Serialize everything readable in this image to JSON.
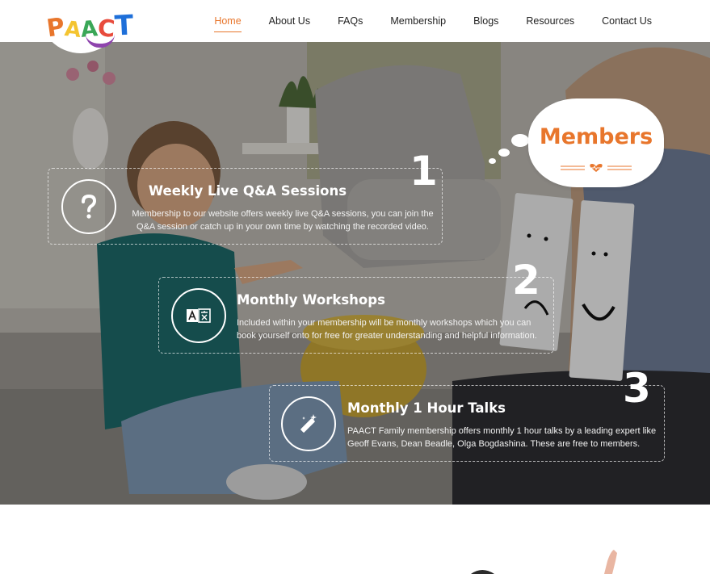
{
  "brand": {
    "logo_letters": [
      "P",
      "A",
      "A",
      "C",
      "T"
    ],
    "logo_colors": [
      "#e8762c",
      "#f4c430",
      "#3aa757",
      "#e84c3d",
      "#1e6fd9"
    ],
    "swoosh_color": "#8e44ad"
  },
  "nav": {
    "items": [
      "Home",
      "About Us",
      "FAQs",
      "Membership",
      "Blogs",
      "Resources",
      "Contact Us"
    ],
    "active": "Home",
    "active_color": "#e8762c"
  },
  "hero": {
    "members_label": "Members",
    "accent": "#e8762c",
    "features": [
      {
        "number": "1",
        "icon": "question-icon",
        "title": "Weekly Live Q&A Sessions",
        "description": "Membership to our website offers weekly live Q&A sessions, you can join the Q&A session or catch up in your own time by watching the recorded video."
      },
      {
        "number": "2",
        "icon": "translate-icon",
        "title": "Monthly Workshops",
        "description": "Included within your membership will be monthly workshops which you can book yourself onto for free for greater understanding and helpful information."
      },
      {
        "number": "3",
        "icon": "magic-wand-icon",
        "title": "Monthly 1 Hour Talks",
        "description": "PAACT Family membership offers monthly 1 hour talks by a leading expert like Geoff Evans, Dean Beadle, Olga Bogdashina. These are free to members."
      }
    ]
  }
}
